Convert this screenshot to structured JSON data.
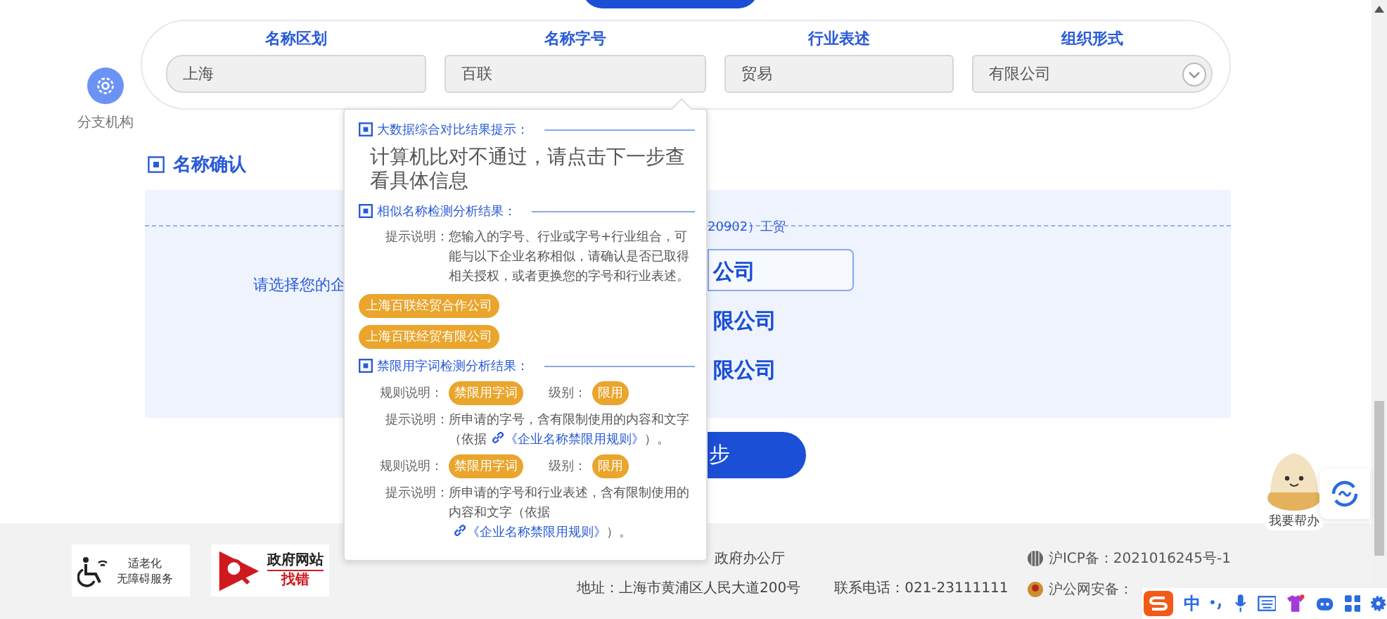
{
  "sidebar": {
    "label": "分支机构"
  },
  "search_form": {
    "fields": [
      {
        "label": "名称区划",
        "value": "上海",
        "kind": "text"
      },
      {
        "label": "名称字号",
        "value": "百联",
        "kind": "text"
      },
      {
        "label": "行业表述",
        "value": "贸易",
        "kind": "text"
      },
      {
        "label": "组织形式",
        "value": "有限公司",
        "kind": "select"
      }
    ]
  },
  "section": {
    "title": "名称确认"
  },
  "confirm_panel": {
    "industry_text": "20902）工贸",
    "prompt": "请选择您的企",
    "options": [
      {
        "text": "公司",
        "selected": true
      },
      {
        "text": "限公司",
        "selected": false
      },
      {
        "text": "限公司",
        "selected": false
      }
    ]
  },
  "next_button": {
    "label": "步"
  },
  "popup": {
    "sections": [
      {
        "kind": "message",
        "title": "大数据综合对比结果提示：",
        "message": "计算机比对不通过，请点击下一步查看具体信息"
      },
      {
        "kind": "similar",
        "title": "相似名称检测分析结果：",
        "hint_label": "提示说明：",
        "hint": "您输入的字号、行业或字号+行业组合，可能与以下企业名称相似，请确认是否已取得相关授权，或者更换您的字号和行业表述。",
        "tags": [
          "上海百联经贸合作公司",
          "上海百联经贸有限公司"
        ]
      },
      {
        "kind": "restricted",
        "title": "禁限用字词检测分析结果：",
        "rules": [
          {
            "rule_label": "规则说明：",
            "rule": "禁限用字词",
            "level_label": "级别：",
            "level": "限用",
            "hint_label": "提示说明：",
            "hint_before": "所申请的字号，含有限制使用的内容和文字（依据",
            "link": "《企业名称禁限用规则》",
            "hint_after": "）。"
          },
          {
            "rule_label": "规则说明：",
            "rule": "禁限用字词",
            "level_label": "级别：",
            "level": "限用",
            "hint_label": "提示说明：",
            "hint_before": "所申请的字号和行业表述，含有限制使用的内容和文字（依据",
            "link": "《企业名称禁限用规则》",
            "hint_after": "）。"
          }
        ]
      }
    ]
  },
  "helper": {
    "label": "我要帮办"
  },
  "footer": {
    "badges": [
      {
        "kind": "accessibility",
        "lines": [
          "适老化",
          "无障碍服务"
        ]
      },
      {
        "kind": "report",
        "title": "政府网站",
        "subtitle": "找错"
      }
    ],
    "host": "政府办公厅",
    "address": "地址：上海市黄浦区人民大道200号",
    "phone": "联系电话：021-23111111",
    "icp": "沪ICP备：2021016245号-1",
    "police": "沪公网安备："
  },
  "ime_toolbar": {
    "lang": "中"
  }
}
